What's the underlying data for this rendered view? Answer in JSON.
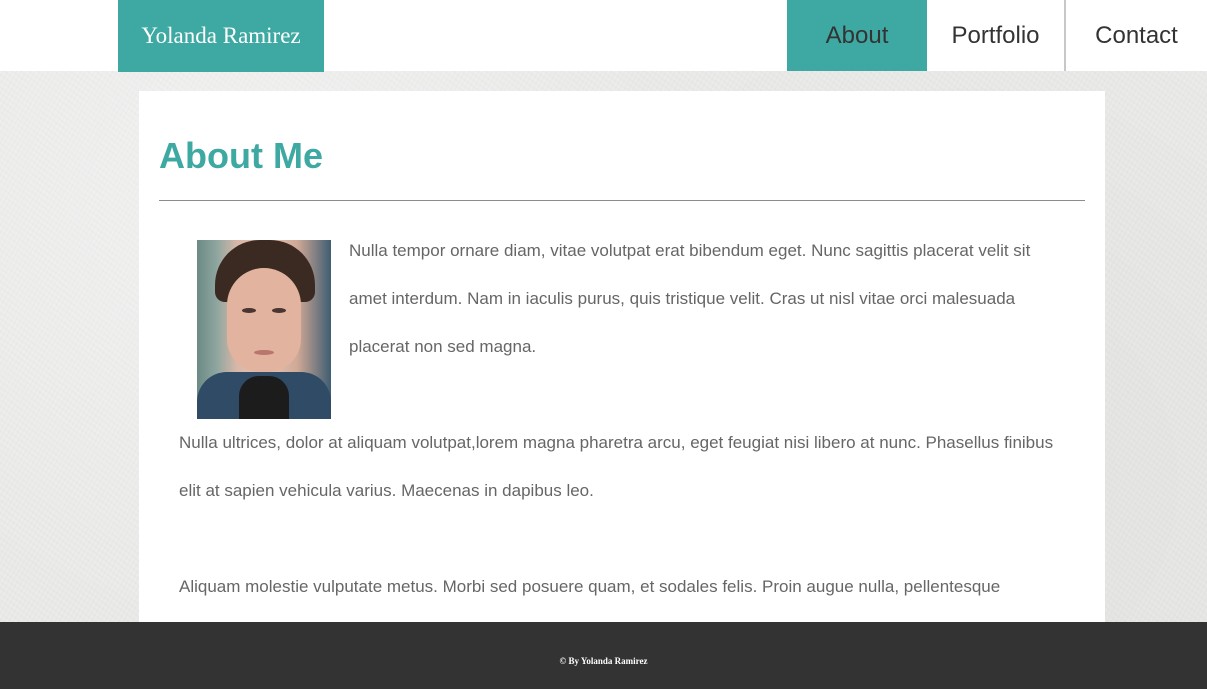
{
  "header": {
    "logo_text": "Yolanda Ramirez",
    "nav": [
      {
        "label": "About",
        "active": true
      },
      {
        "label": "Portfolio",
        "active": false
      },
      {
        "label": "Contact",
        "active": false
      }
    ]
  },
  "main": {
    "title": "About Me",
    "paragraphs": [
      "Nulla tempor ornare diam, vitae volutpat erat bibendum eget. Nunc sagittis placerat velit sit amet interdum. Nam in iaculis purus, quis tristique velit. Cras ut nisl vitae orci malesuada placerat non sed magna.",
      "Nulla ultrices, dolor at aliquam volutpat,lorem magna pharetra arcu, eget feugiat nisi libero at nunc. Phasellus finibus elit at sapien vehicula varius. Maecenas in dapibus leo.",
      "Aliquam molestie vulputate metus. Morbi sed posuere quam, et sodales felis. Proin augue nulla, pellentesque"
    ]
  },
  "footer": {
    "text": "© By Yolanda Ramirez"
  },
  "colors": {
    "accent": "#3ea8a2",
    "footer_bg": "#333333",
    "body_text": "#666666"
  }
}
